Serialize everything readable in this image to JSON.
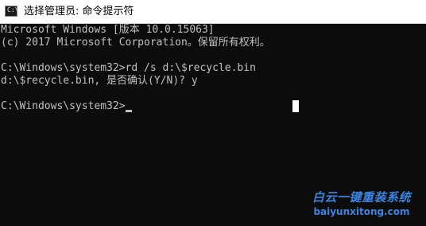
{
  "window": {
    "title": "选择管理员: 命令提示符"
  },
  "console": {
    "lines": [
      "Microsoft Windows [版本 10.0.15063]",
      "(c) 2017 Microsoft Corporation。保留所有权利。",
      "",
      "C:\\Windows\\system32>rd /s d:\\$recycle.bin",
      "d:\\$recycle.bin, 是否确认(Y/N)? y",
      "",
      "C:\\Windows\\system32>"
    ]
  },
  "watermark": {
    "title": "白云一键重装系统",
    "url": "baiyunxitong.com"
  },
  "colors": {
    "console_bg": "#0c0c0c",
    "console_text": "#c0c0c0",
    "watermark": "#3b84e0"
  },
  "icons": {
    "app": "cmd-icon"
  }
}
